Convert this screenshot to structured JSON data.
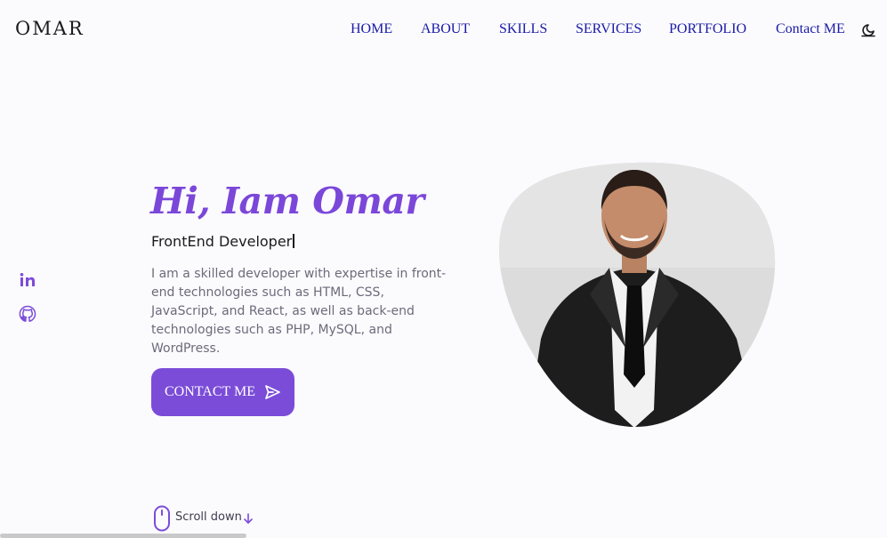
{
  "header": {
    "logo": "OMAR",
    "nav": [
      {
        "label": "HOME"
      },
      {
        "label": "ABOUT"
      },
      {
        "label": "SKILLS"
      },
      {
        "label": "SERVICES"
      },
      {
        "label": "PORTFOLIO"
      },
      {
        "label": "Contact ME"
      }
    ],
    "theme_toggle_icon": "moon-icon"
  },
  "socials": [
    {
      "icon": "linkedin-icon"
    },
    {
      "icon": "github-icon"
    }
  ],
  "hero": {
    "title": "Hi, Iam Omar",
    "subtitle": "FrontEnd Developer",
    "description": "I am a skilled developer with expertise in front-end technologies such as HTML, CSS, JavaScript, and React, as well as back-end technologies such as PHP, MySQL, and WordPress.",
    "contact_button": {
      "label": "CONTACT ME",
      "icon": "send-icon"
    },
    "profile_image": "profile-photo-blob"
  },
  "scroll": {
    "label": "Scroll down",
    "icons": [
      "mouse-icon",
      "arrow-down-icon"
    ]
  },
  "colors": {
    "accent": "#7b4cd8",
    "title": "#7b47d9",
    "nav_link": "#1a1aa6",
    "background": "#fbfbfe",
    "text_muted": "#6e6a7a"
  }
}
